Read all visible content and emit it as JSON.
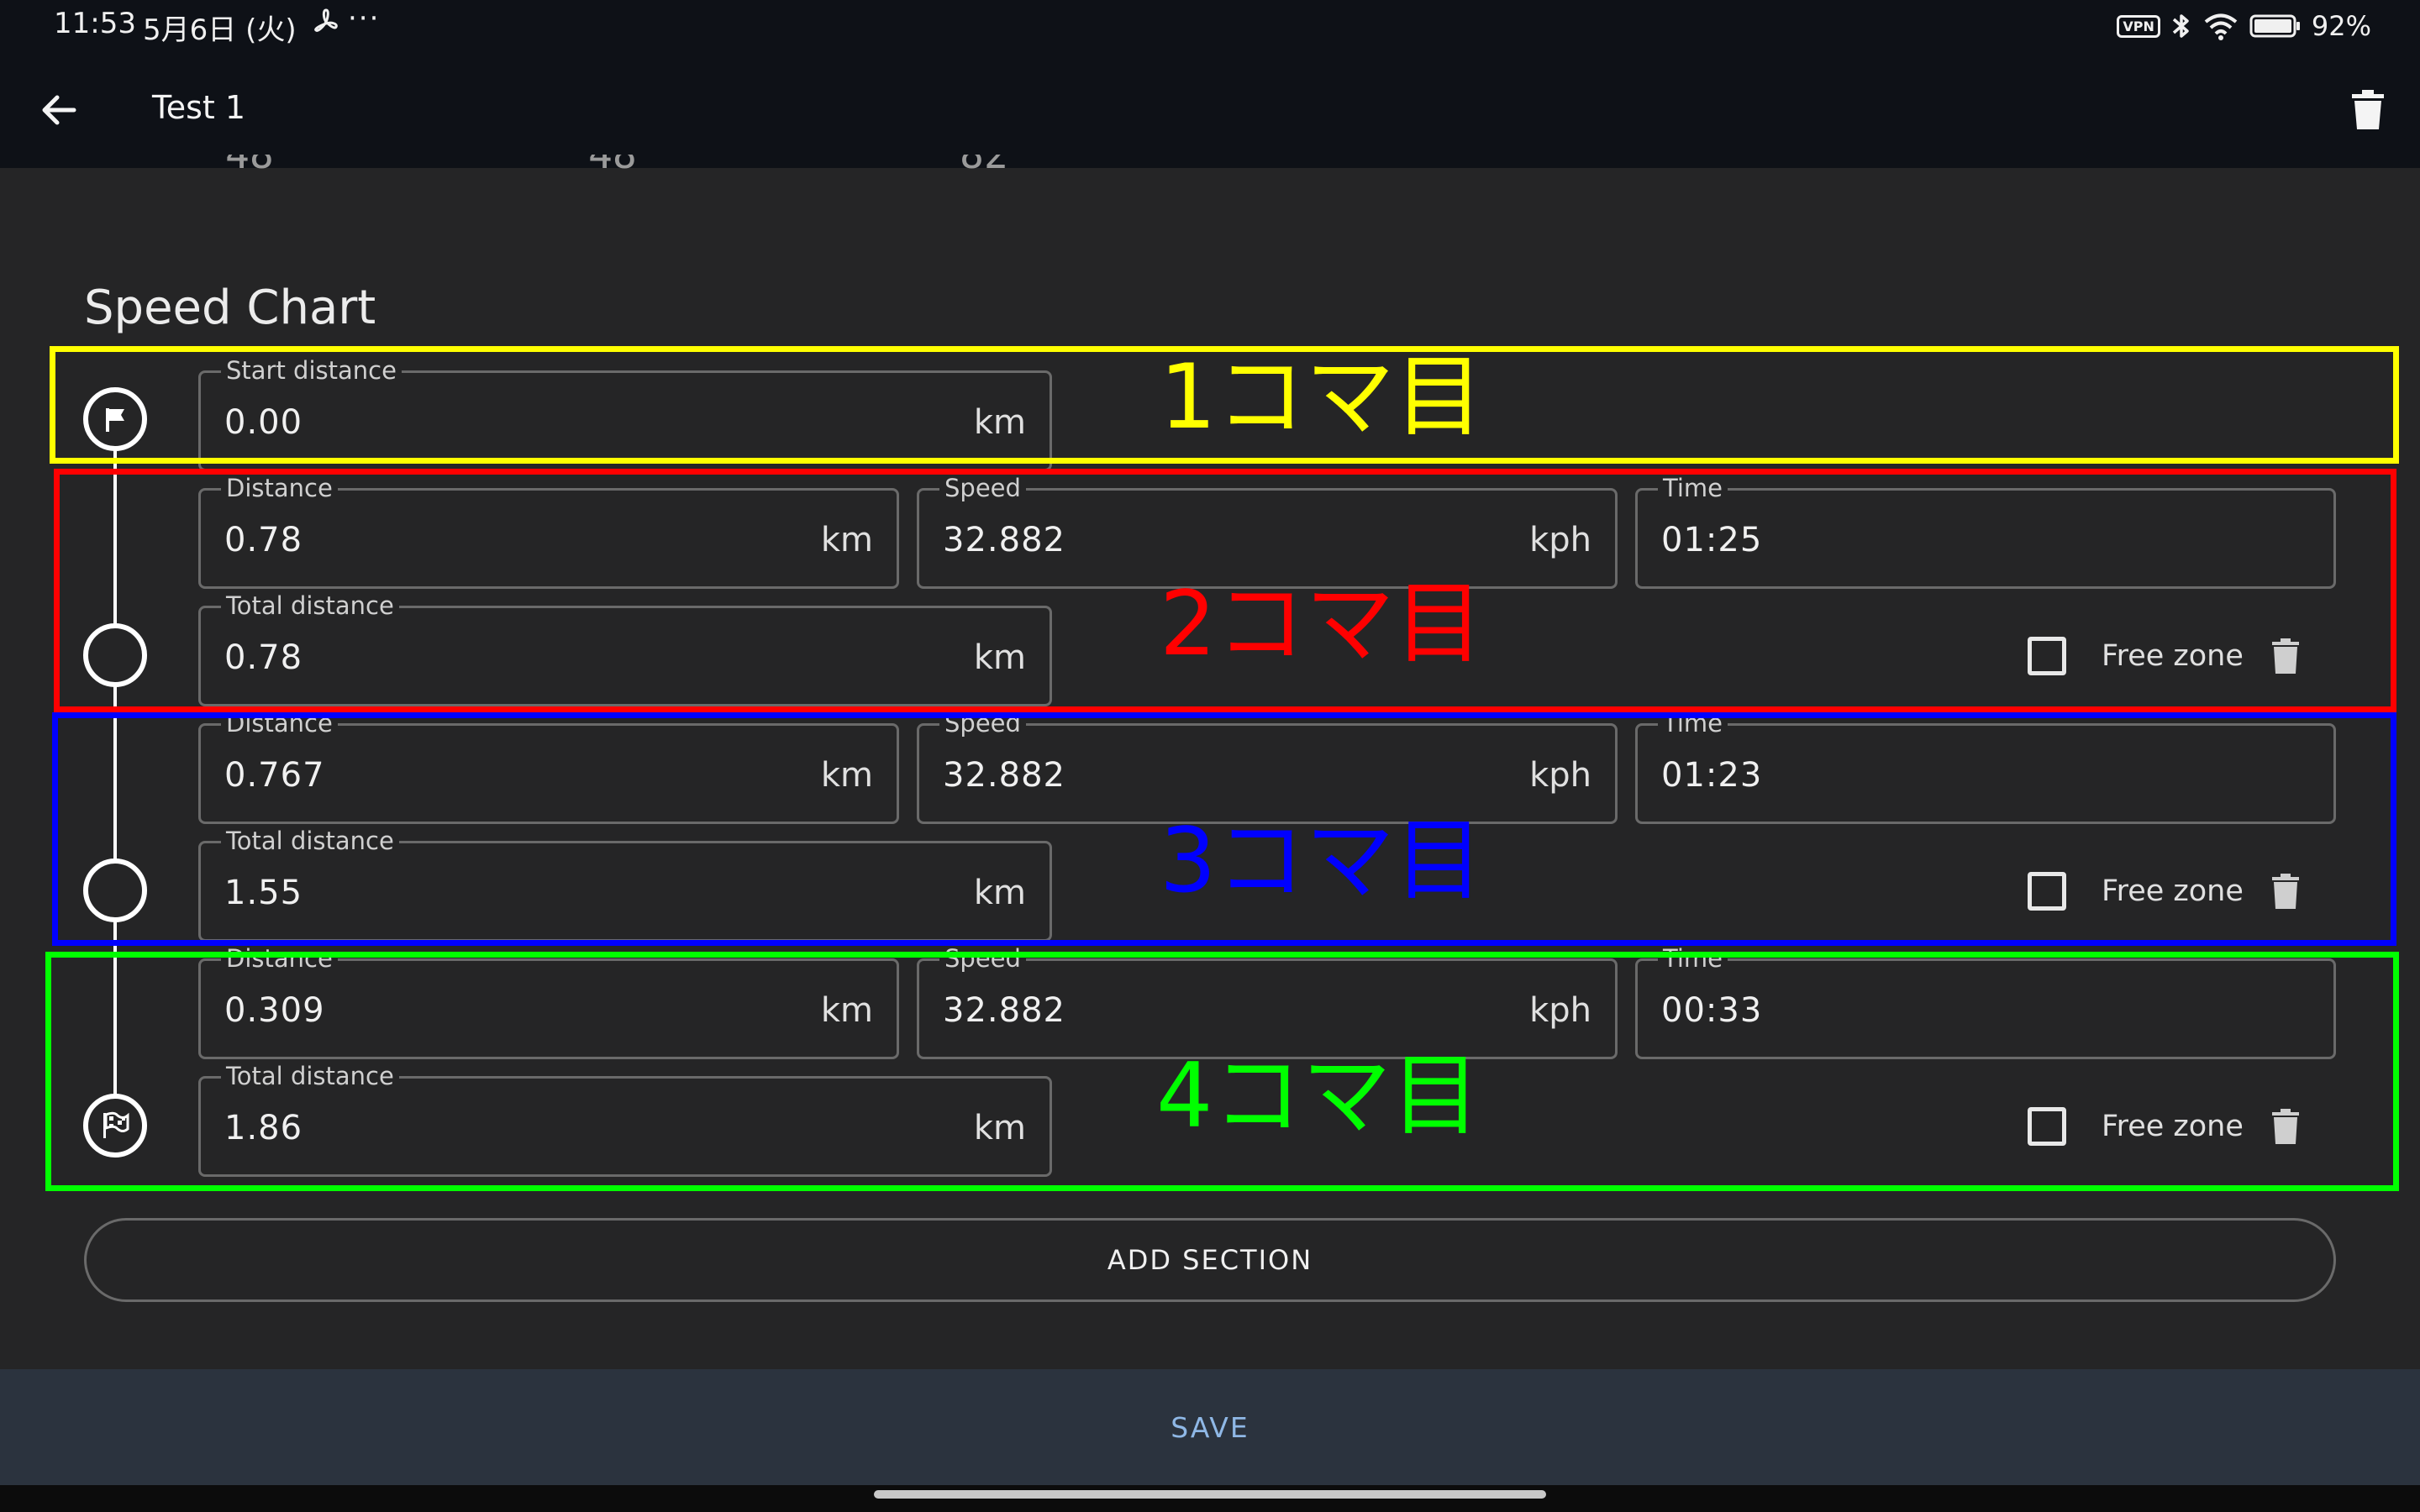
{
  "status_bar": {
    "time": "11:53",
    "date": "5月6日 (火)",
    "more": "···",
    "vpn": "VPN",
    "battery_percent": "92%"
  },
  "app_bar": {
    "title": "Test 1"
  },
  "clipped_summary": [
    "48",
    "48",
    "82"
  ],
  "section_title": "Speed Chart",
  "start": {
    "label": "Start distance",
    "value": "0.00",
    "unit": "km"
  },
  "rows": [
    {
      "distance_label": "Distance",
      "distance_value": "0.78",
      "distance_unit": "km",
      "speed_label": "Speed",
      "speed_value": "32.882",
      "speed_unit": "kph",
      "time_label": "Time",
      "time_value": "01:25",
      "total_label": "Total distance",
      "total_value": "0.78",
      "total_unit": "km",
      "freezone_label": "Free zone",
      "freezone_checked": false
    },
    {
      "distance_label": "Distance",
      "distance_value": "0.767",
      "distance_unit": "km",
      "speed_label": "Speed",
      "speed_value": "32.882",
      "speed_unit": "kph",
      "time_label": "Time",
      "time_value": "01:23",
      "total_label": "Total distance",
      "total_value": "1.55",
      "total_unit": "km",
      "freezone_label": "Free zone",
      "freezone_checked": false
    },
    {
      "distance_label": "Distance",
      "distance_value": "0.309",
      "distance_unit": "km",
      "speed_label": "Speed",
      "speed_value": "32.882",
      "speed_unit": "kph",
      "time_label": "Time",
      "time_value": "00:33",
      "total_label": "Total distance",
      "total_value": "1.86",
      "total_unit": "km",
      "freezone_label": "Free zone",
      "freezone_checked": false
    }
  ],
  "annotations": [
    {
      "text": "1コマ目",
      "color": "#ffff00"
    },
    {
      "text": "2コマ目",
      "color": "#ff0000"
    },
    {
      "text": "3コマ目",
      "color": "#0000ff"
    },
    {
      "text": "4コマ目",
      "color": "#00ff00"
    }
  ],
  "buttons": {
    "add_section": "ADD SECTION",
    "save": "SAVE"
  },
  "icons": {
    "back": "arrow-left-icon",
    "delete": "trash-icon",
    "start_node": "flag-icon",
    "finish_node": "checkered-flag-icon"
  }
}
